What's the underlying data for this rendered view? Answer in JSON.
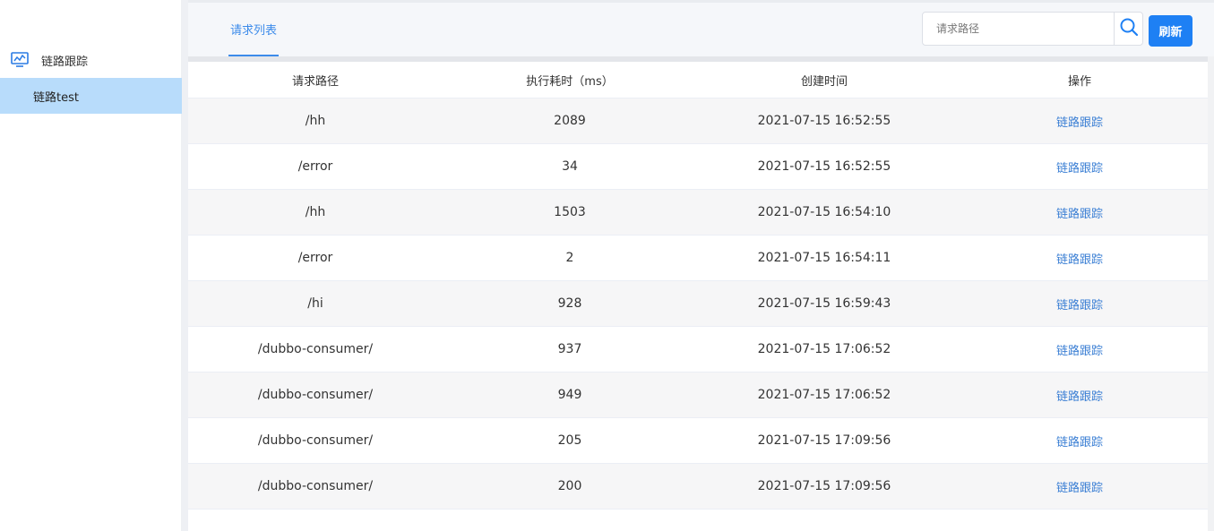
{
  "sidebar": {
    "group_label": "链路跟踪",
    "active_item": "链路test"
  },
  "topbar": {
    "tab_label": "请求列表",
    "search_placeholder": "请求路径",
    "refresh_label": "刷新"
  },
  "table": {
    "headers": [
      "请求路径",
      "执行耗时（ms）",
      "创建时间",
      "操作"
    ],
    "rows": [
      {
        "path": "/hh",
        "duration": "2089",
        "created": "2021-07-15 16:52:55",
        "action": "链路跟踪"
      },
      {
        "path": "/error",
        "duration": "34",
        "created": "2021-07-15 16:52:55",
        "action": "链路跟踪"
      },
      {
        "path": "/hh",
        "duration": "1503",
        "created": "2021-07-15 16:54:10",
        "action": "链路跟踪"
      },
      {
        "path": "/error",
        "duration": "2",
        "created": "2021-07-15 16:54:11",
        "action": "链路跟踪"
      },
      {
        "path": "/hi",
        "duration": "928",
        "created": "2021-07-15 16:59:43",
        "action": "链路跟踪"
      },
      {
        "path": "/dubbo-consumer/",
        "duration": "937",
        "created": "2021-07-15 17:06:52",
        "action": "链路跟踪"
      },
      {
        "path": "/dubbo-consumer/",
        "duration": "949",
        "created": "2021-07-15 17:06:52",
        "action": "链路跟踪"
      },
      {
        "path": "/dubbo-consumer/",
        "duration": "205",
        "created": "2021-07-15 17:09:56",
        "action": "链路跟踪"
      },
      {
        "path": "/dubbo-consumer/",
        "duration": "200",
        "created": "2021-07-15 17:09:56",
        "action": "链路跟踪"
      }
    ]
  },
  "icons": {
    "nav_group": "monitor-chart-icon",
    "search": "search-icon"
  },
  "colors": {
    "accent": "#1e80f4",
    "link": "#3b7fd4",
    "active_nav_bg": "#b8dcfb"
  }
}
